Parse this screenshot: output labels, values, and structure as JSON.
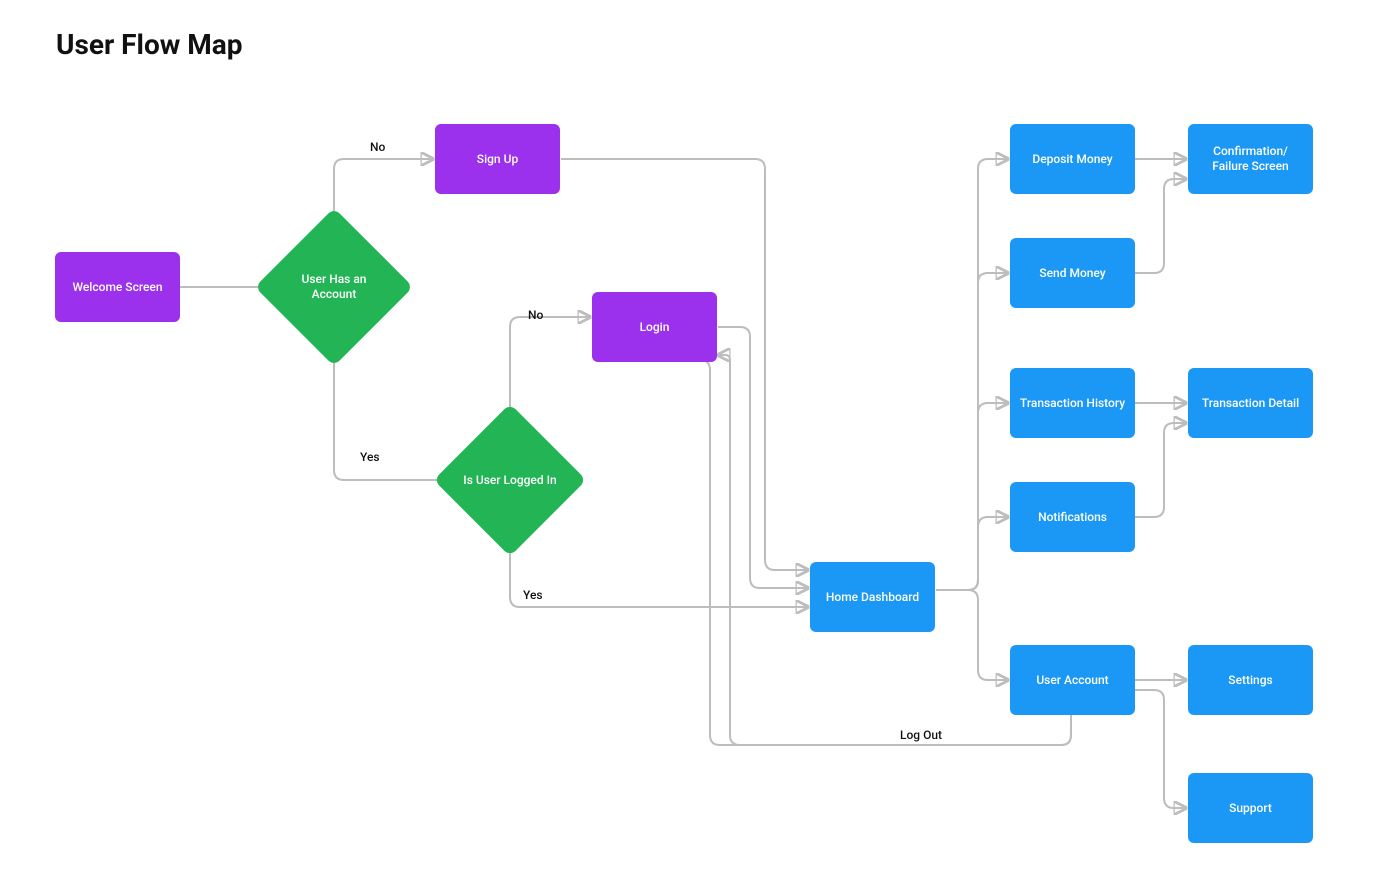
{
  "title": "User Flow Map",
  "colors": {
    "screen": "#9b30ed",
    "decision": "#22b455",
    "page": "#1b98f5",
    "connector": "#bdbdbd"
  },
  "nodes": {
    "welcome": {
      "label": "Welcome Screen",
      "type": "screen"
    },
    "has_account": {
      "label": "User Has an Account",
      "type": "decision"
    },
    "signup": {
      "label": "Sign Up",
      "type": "screen"
    },
    "logged_in": {
      "label": "Is User Logged In",
      "type": "decision"
    },
    "login": {
      "label": "Login",
      "type": "screen"
    },
    "home": {
      "label": "Home Dashboard",
      "type": "page"
    },
    "deposit": {
      "label": "Deposit Money",
      "type": "page"
    },
    "send": {
      "label": "Send Money",
      "type": "page"
    },
    "history": {
      "label": "Transaction History",
      "type": "page"
    },
    "notifications": {
      "label": "Notifications",
      "type": "page"
    },
    "account": {
      "label": "User Account",
      "type": "page"
    },
    "confirm": {
      "label": "Confirmation/ Failure Screen",
      "type": "page"
    },
    "tx_detail": {
      "label": "Transaction Detail",
      "type": "page"
    },
    "settings": {
      "label": "Settings",
      "type": "page"
    },
    "support": {
      "label": "Support",
      "type": "page"
    }
  },
  "edges": [
    {
      "from": "welcome",
      "to": "has_account"
    },
    {
      "from": "has_account",
      "to": "signup",
      "label": "No"
    },
    {
      "from": "has_account",
      "to": "logged_in",
      "label": "Yes"
    },
    {
      "from": "logged_in",
      "to": "login",
      "label": "No"
    },
    {
      "from": "logged_in",
      "to": "home",
      "label": "Yes"
    },
    {
      "from": "signup",
      "to": "home"
    },
    {
      "from": "login",
      "to": "home"
    },
    {
      "from": "home",
      "to": "deposit"
    },
    {
      "from": "home",
      "to": "send"
    },
    {
      "from": "home",
      "to": "history"
    },
    {
      "from": "home",
      "to": "notifications"
    },
    {
      "from": "home",
      "to": "account"
    },
    {
      "from": "deposit",
      "to": "confirm"
    },
    {
      "from": "send",
      "to": "confirm"
    },
    {
      "from": "history",
      "to": "tx_detail"
    },
    {
      "from": "notifications",
      "to": "tx_detail"
    },
    {
      "from": "account",
      "to": "settings"
    },
    {
      "from": "account",
      "to": "support"
    },
    {
      "from": "account",
      "to": "login",
      "label": "Log Out"
    }
  ],
  "edge_labels": {
    "no1": "No",
    "yes1": "Yes",
    "no2": "No",
    "yes2": "Yes",
    "logout": "Log Out"
  }
}
